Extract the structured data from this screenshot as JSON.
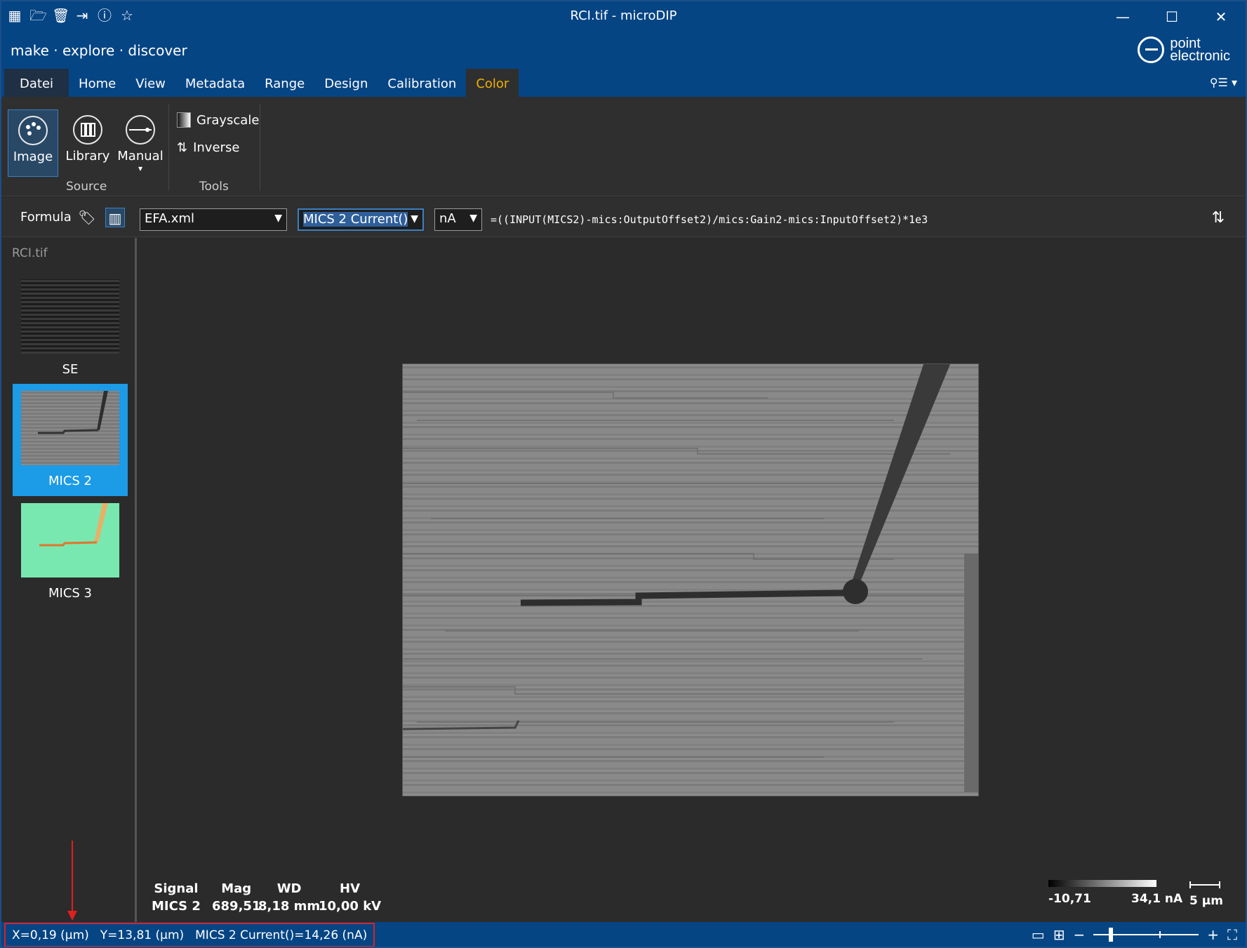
{
  "window": {
    "title": "RCI.tif - microDIP",
    "controls": {
      "minimize": "—",
      "maximize": "☐",
      "close": "✕"
    }
  },
  "quick_access": [
    {
      "name": "app-icon",
      "glyph": "▦"
    },
    {
      "name": "open-folder-icon",
      "glyph": "🗁"
    },
    {
      "name": "trash-icon",
      "glyph": "🗑"
    },
    {
      "name": "export-icon",
      "glyph": "⇥"
    },
    {
      "name": "info-icon",
      "glyph": "ⓘ"
    },
    {
      "name": "star-icon",
      "glyph": "☆"
    }
  ],
  "brand": {
    "tagline": "make · explore · discover",
    "logo_line1": "point",
    "logo_line2": "electronic"
  },
  "menu": {
    "tabs": [
      "Datei",
      "Home",
      "View",
      "Metadata",
      "Range",
      "Design",
      "Calibration",
      "Color"
    ],
    "active": "Color",
    "right_glyph": "⚲☰ ▾"
  },
  "ribbon": {
    "source": {
      "label": "Source",
      "buttons": [
        {
          "label": "Image",
          "selected": true
        },
        {
          "label": "Library",
          "selected": false
        },
        {
          "label": "Manual",
          "selected": false,
          "dropdown": "▾"
        }
      ]
    },
    "tools": {
      "label": "Tools",
      "items": [
        {
          "label": "Grayscale"
        },
        {
          "label": "Inverse",
          "glyph": "⇅"
        }
      ]
    }
  },
  "formula_bar": {
    "label": "Formula",
    "tag_glyph": "🏷",
    "library_glyph": "▥",
    "file_combo": "EFA.xml",
    "signal_combo": "MICS 2 Current()",
    "unit_combo": "nA",
    "expression": "=((INPUT(MICS2)-mics:OutputOffset2)/mics:Gain2-mics:InputOffset2)*1e3",
    "swap_glyph": "⇅"
  },
  "left_panel": {
    "title": "RCI.tif",
    "thumbnails": [
      {
        "label": "SE",
        "selected": false
      },
      {
        "label": "MICS 2",
        "selected": true
      },
      {
        "label": "MICS 3",
        "selected": false
      }
    ]
  },
  "image_meta": {
    "signal": {
      "header": "Signal",
      "value": "MICS 2"
    },
    "mag": {
      "header": "Mag",
      "value": "689,51"
    },
    "wd": {
      "header": "WD",
      "value": "8,18 mm"
    },
    "hv": {
      "header": "HV",
      "value": "10,00 kV"
    }
  },
  "colorbar": {
    "min": "-10,71",
    "max": "34,1 nA"
  },
  "scalebar": {
    "label": "5 µm"
  },
  "status": {
    "x": "X=0,19 (µm)",
    "y": "Y=13,81 (µm)",
    "value": "MICS 2 Current()=14,26 (nA)",
    "view_single_glyph": "▭",
    "view_grid_glyph": "⊞",
    "zoom_out": "−",
    "zoom_in": "+",
    "fit_glyph": "⛶",
    "zoom_level": 0.15
  },
  "colors": {
    "title_bar": "#064584",
    "accent_tab": "#f0b000",
    "selected": "#1c9be6",
    "highlight_box": "#e0201d"
  }
}
